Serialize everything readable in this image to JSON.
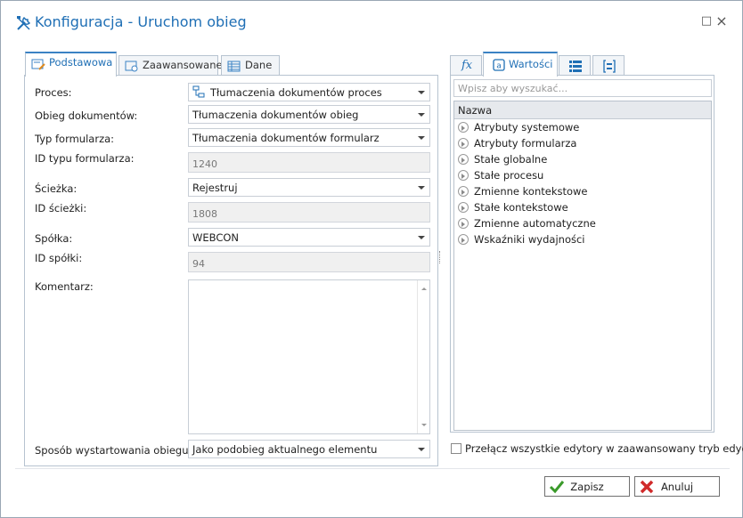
{
  "window": {
    "title": "Konfiguracja - Uruchom obieg",
    "icon": "tools-icon",
    "maximize_glyph": "□",
    "close_glyph": "×"
  },
  "left_tabs": [
    {
      "label": "Podstawowa",
      "icon": "form-edit-icon",
      "active": true
    },
    {
      "label": "Zaawansowane",
      "icon": "form-gear-icon",
      "active": false
    },
    {
      "label": "Dane",
      "icon": "table-icon",
      "active": false
    }
  ],
  "form": {
    "process": {
      "label": "Proces:",
      "value": "Tłumaczenia dokumentów proces",
      "icon": "process-icon"
    },
    "workflow": {
      "label": "Obieg dokumentów:",
      "value": "Tłumaczenia dokumentów obieg"
    },
    "form_type": {
      "label": "Typ formularza:",
      "value": "Tłumaczenia dokumentów formularz"
    },
    "form_type_id": {
      "label": "ID typu formularza:",
      "value": "1240"
    },
    "path": {
      "label": "Ścieżka:",
      "value": "Rejestruj"
    },
    "path_id": {
      "label": "ID ścieżki:",
      "value": "1808"
    },
    "company": {
      "label": "Spółka:",
      "value": "WEBCON"
    },
    "company_id": {
      "label": "ID spółki:",
      "value": "94"
    },
    "comment": {
      "label": "Komentarz:",
      "value": ""
    },
    "start_mode": {
      "label": "Sposób wystartowania obiegu:",
      "value": "Jako podobieg aktualnego elementu"
    }
  },
  "right_tabs": [
    {
      "label": "fx",
      "icon": "function-icon",
      "active": false
    },
    {
      "label": "Wartości",
      "icon": "values-icon",
      "active": true
    },
    {
      "label": "",
      "icon": "list-icon",
      "active": false
    },
    {
      "label": "",
      "icon": "bracket-list-icon",
      "active": false
    }
  ],
  "values_panel": {
    "search_placeholder": "Wpisz aby wyszukać...",
    "column_header": "Nazwa",
    "items": [
      "Atrybuty systemowe",
      "Atrybuty formularza",
      "Stałe globalne",
      "Stałe procesu",
      "Zmienne kontekstowe",
      "Stałe kontekstowe",
      "Zmienne automatyczne",
      "Wskaźniki wydajności"
    ]
  },
  "advanced_toggle": {
    "label": "Przełącz wszystkie edytory w zaawansowany tryb edycji",
    "checked": false
  },
  "buttons": {
    "save": "Zapisz",
    "cancel": "Anuluj"
  },
  "colors": {
    "accent": "#1f6fb5",
    "save_check": "#3a9a2a",
    "cancel_x": "#d02a2a"
  }
}
